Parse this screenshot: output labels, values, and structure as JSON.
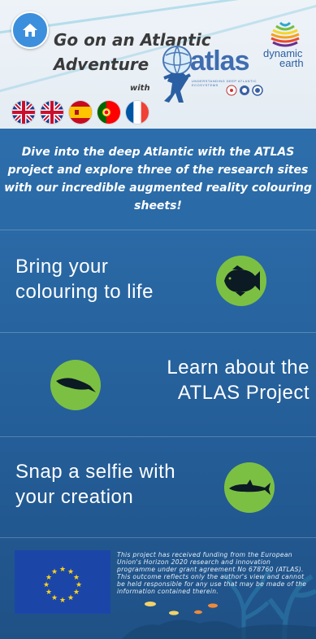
{
  "header": {
    "title_line1": "Go on an Atlantic",
    "title_line2": "Adventure",
    "with_label": "with",
    "atlas_logo_text": "atlas",
    "atlas_tagline": "UNDERSTANDING DEEP ATLANTIC ECOSYSTEMS",
    "dynamic_earth_line1": "dynamic",
    "dynamic_earth_line2": "earth"
  },
  "icons": {
    "home": "home-icon",
    "flags": [
      "uk-flag",
      "uk-flag",
      "spain-flag",
      "portugal-flag",
      "france-flag"
    ]
  },
  "intro": {
    "text": "Dive into the deep Atlantic with the ATLAS project and explore three of the research sites with our incredible augmented reality colouring sheets!"
  },
  "panels": [
    {
      "line1": "Bring your",
      "line2": "colouring to life",
      "icon": "fish-icon"
    },
    {
      "line1": "Learn about the",
      "line2": "ATLAS Project",
      "icon": "ray-icon"
    },
    {
      "line1": "Snap a selfie with",
      "line2": "your creation",
      "icon": "shark-icon"
    }
  ],
  "footer": {
    "funding_text": "This project has received funding from the European Union's Horizon 2020 research and innovation programme under grant agreement No 678760 (ATLAS). This outcome reflects only the author's view and cannot be held responsible for any use that may be made of the information contained therein."
  },
  "colors": {
    "background": "#2a6aa6",
    "icon_circle": "#7cc043",
    "home_button": "#3c8fdc",
    "eu_blue": "#1b46a8",
    "eu_star": "#ffd617"
  }
}
